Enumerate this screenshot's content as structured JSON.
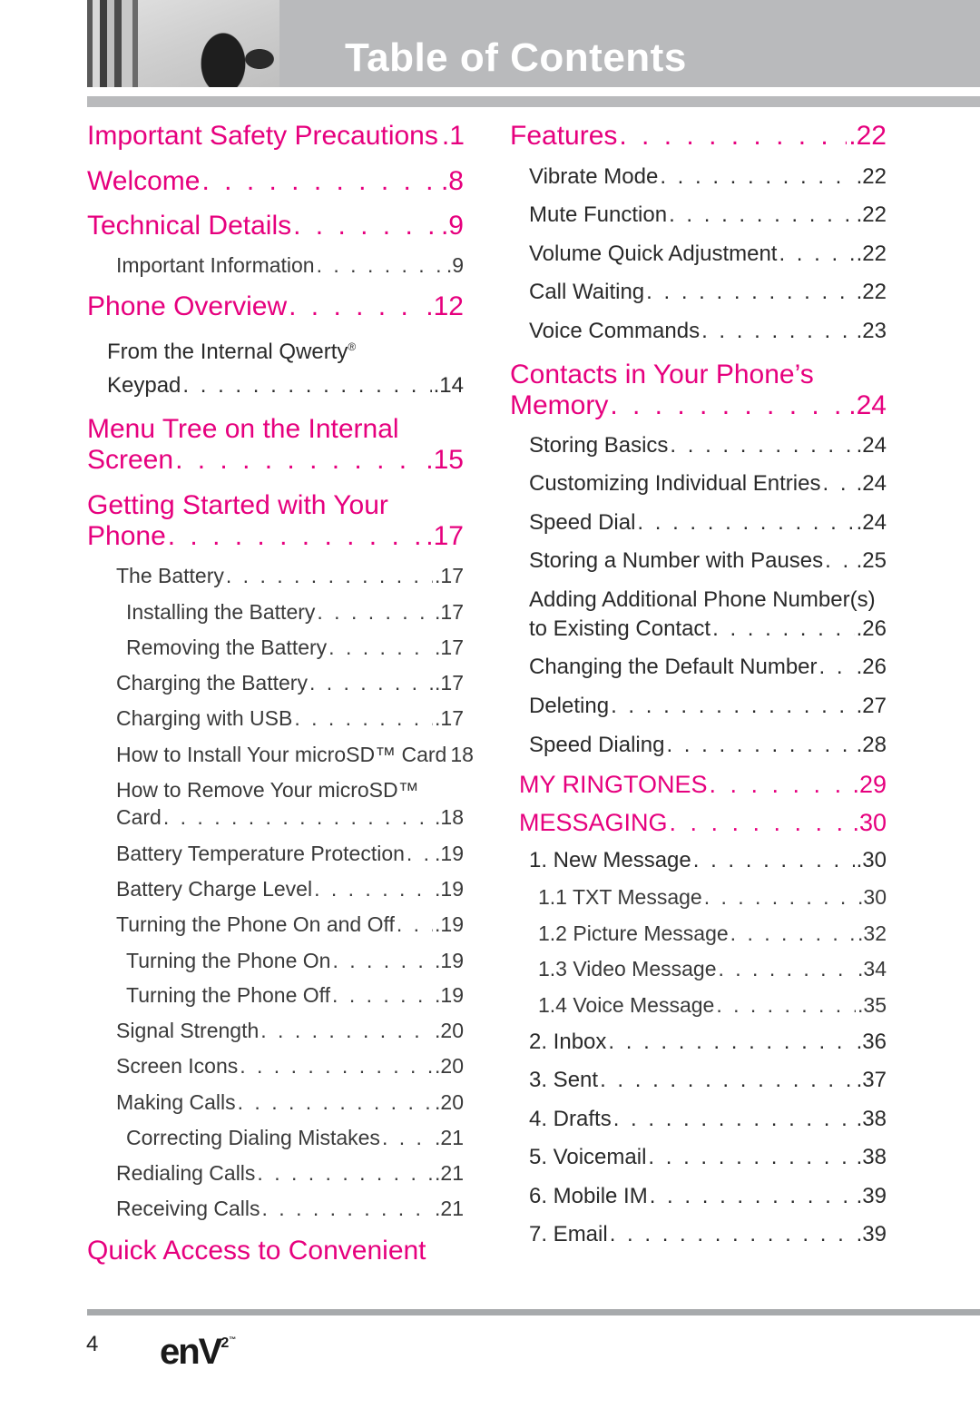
{
  "header": {
    "title": "Table of Contents",
    "photo": "header-photo"
  },
  "left_column": {
    "important_safety": {
      "label": "Important Safety Precautions",
      "page": ".1"
    },
    "welcome": {
      "label": "Welcome",
      "page": ".8"
    },
    "technical_details": {
      "label": "Technical Details",
      "page": ".9"
    },
    "important_information": {
      "label": "Important Information",
      "page": ".9"
    },
    "phone_overview": {
      "label": "Phone Overview",
      "page": ".12"
    },
    "from_internal_qwerty": {
      "line1": "From the Internal Qwerty",
      "reg": "®",
      "line2": "Keypad",
      "page": ".14"
    },
    "menu_tree": {
      "line1": "Menu Tree on the Internal",
      "line2": "Screen",
      "page": ".15"
    },
    "getting_started": {
      "line1": "Getting Started with Your",
      "line2": "Phone",
      "page": ".17"
    },
    "the_battery": {
      "label": "The Battery",
      "page": ".17"
    },
    "installing_battery": {
      "label": "Installing the Battery",
      "page": ".17"
    },
    "removing_battery": {
      "label": "Removing the Battery",
      "page": ".17"
    },
    "charging_battery": {
      "label": "Charging the Battery",
      "page": ".17"
    },
    "charging_usb": {
      "label": "Charging with USB",
      "page": ".17"
    },
    "install_microsd": {
      "label": "How to Install Your microSD™ Card",
      "page": "18"
    },
    "remove_microsd": {
      "line1": "How to Remove Your microSD™",
      "line2": "Card",
      "page": ".18"
    },
    "battery_temp": {
      "label": "Battery Temperature Protection",
      "page": ".19"
    },
    "battery_charge_level": {
      "label": "Battery Charge Level",
      "page": ".19"
    },
    "turning_on_off": {
      "label": "Turning the Phone On and Off",
      "page": ".19"
    },
    "turning_on": {
      "label": "Turning the Phone On",
      "page": ".19"
    },
    "turning_off": {
      "label": "Turning the Phone Off",
      "page": ".19"
    },
    "signal_strength": {
      "label": "Signal Strength",
      "page": ".20"
    },
    "screen_icons": {
      "label": "Screen Icons",
      "page": ".20"
    },
    "making_calls": {
      "label": "Making Calls",
      "page": ".20"
    },
    "correcting_dialing": {
      "label": "Correcting Dialing Mistakes",
      "page": ".21"
    },
    "redialing_calls": {
      "label": "Redialing Calls",
      "page": ".21"
    },
    "receiving_calls": {
      "label": "Receiving Calls",
      "page": ".21"
    },
    "quick_access": {
      "line1": "Quick Access to Convenient"
    }
  },
  "right_column": {
    "features": {
      "label": "Features",
      "page": ".22"
    },
    "vibrate_mode": {
      "label": "Vibrate Mode",
      "page": ".22"
    },
    "mute_function": {
      "label": "Mute Function",
      "page": ".22"
    },
    "volume_quick": {
      "label": "Volume Quick Adjustment",
      "page": ".22"
    },
    "call_waiting": {
      "label": "Call Waiting",
      "page": ".22"
    },
    "voice_commands": {
      "label": "Voice Commands",
      "page": ".23"
    },
    "contacts_memory": {
      "line1": "Contacts in Your Phone’s",
      "line2": "Memory",
      "page": ".24"
    },
    "storing_basics": {
      "label": "Storing Basics",
      "page": ".24"
    },
    "customizing_entries": {
      "label": "Customizing Individual Entries",
      "page": ".24"
    },
    "speed_dial": {
      "label": "Speed Dial",
      "page": ".24"
    },
    "storing_pauses": {
      "label": "Storing a Number with Pauses",
      "page": ".25"
    },
    "adding_numbers": {
      "line1": "Adding Additional Phone Number(s)",
      "line2": "to Existing Contact",
      "page": ".26"
    },
    "changing_default": {
      "label": "Changing the Default Number",
      "page": ".26"
    },
    "deleting": {
      "label": "Deleting",
      "page": ".27"
    },
    "speed_dialing": {
      "label": "Speed Dialing",
      "page": ".28"
    },
    "my_ringtones": {
      "label": "MY RINGTONES",
      "page": ".29"
    },
    "messaging": {
      "label": "MESSAGING",
      "page": ".30"
    },
    "new_message": {
      "label": "1. New Message",
      "page": ".30"
    },
    "txt_message": {
      "label": "1.1 TXT Message",
      "page": ".30"
    },
    "picture_message": {
      "label": "1.2 Picture Message",
      "page": ".32"
    },
    "video_message": {
      "label": "1.3 Video Message",
      "page": ".34"
    },
    "voice_message": {
      "label": "1.4 Voice Message",
      "page": ".35"
    },
    "inbox": {
      "label": "2. Inbox",
      "page": ".36"
    },
    "sent": {
      "label": "3. Sent",
      "page": ".37"
    },
    "drafts": {
      "label": "4. Drafts",
      "page": ".38"
    },
    "voicemail": {
      "label": "5. Voicemail",
      "page": ".38"
    },
    "mobile_im": {
      "label": "6. Mobile IM",
      "page": ".39"
    },
    "email": {
      "label": "7. Email",
      "page": ".39"
    }
  },
  "footer": {
    "page_number": "4",
    "brand": "enV",
    "brand_sup": "2",
    "brand_tm": "™"
  },
  "colors": {
    "accent": "#e6007e",
    "header_gray": "#b9babc",
    "rule_gray": "#a7aaac",
    "text": "#2a2a2a"
  }
}
